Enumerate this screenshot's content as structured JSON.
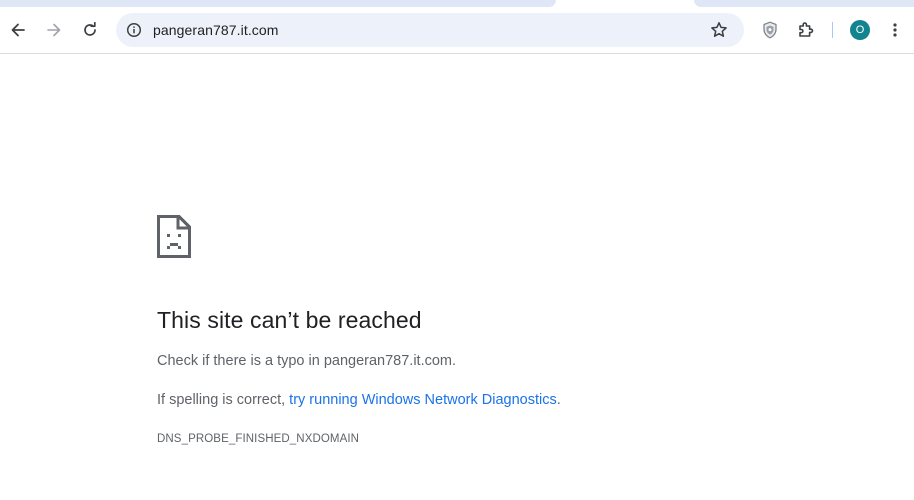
{
  "toolbar": {
    "back_icon": "arrow-left-icon",
    "forward_icon": "arrow-right-icon",
    "reload_icon": "reload-icon",
    "site_info_icon": "info-icon",
    "bookmark_icon": "star-icon",
    "shield_icon": "shield-icon",
    "extensions_icon": "puzzle-icon",
    "menu_icon": "more-vertical-icon",
    "avatar_initial": "O",
    "avatar_color": "#12838f"
  },
  "omnibox": {
    "url": "pangeran787.it.com"
  },
  "error": {
    "title": "This site can’t be reached",
    "line1": "Check if there is a typo in pangeran787.it.com.",
    "line2_prefix": "If spelling is correct, ",
    "line2_link": "try running Windows Network Diagnostics",
    "line2_suffix": ".",
    "code": "DNS_PROBE_FINISHED_NXDOMAIN",
    "icon": "sad-page-icon"
  },
  "colors": {
    "link": "#1a73e8",
    "title": "#202124",
    "body_text": "#5f6368",
    "omnibox_bg": "#edf2fa"
  }
}
